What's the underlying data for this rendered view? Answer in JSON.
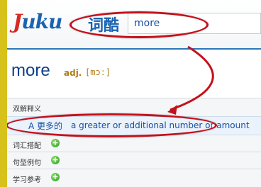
{
  "logo": {
    "text_main": "Juku",
    "suffix": "词酷"
  },
  "search": {
    "value": "more"
  },
  "entry": {
    "word": "more",
    "pos": "adj.",
    "phonetic": "[mɔː]"
  },
  "sections": {
    "explain": "双解释义",
    "definition_cn": "A 更多的",
    "definition_en": "a greater or additional number or amount",
    "collocations": "词汇搭配",
    "examples": "句型例句",
    "study": "学习参考"
  },
  "colors": {
    "annotation": "#c4101a",
    "brand": "#1a63b0",
    "accent_bg": "#d6c21a"
  }
}
